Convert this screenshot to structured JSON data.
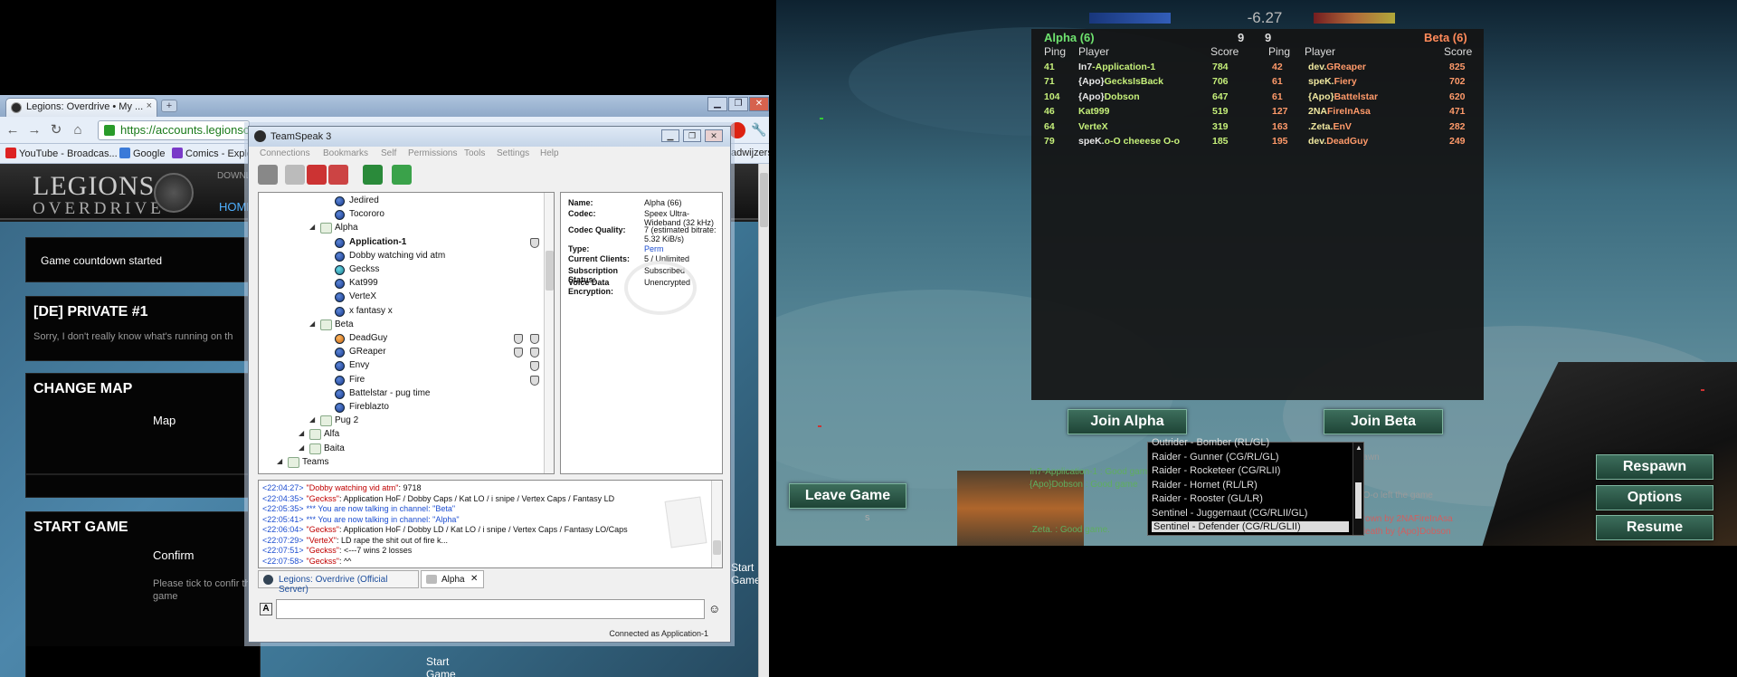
{
  "browser": {
    "tab_title": "Legions: Overdrive • My ...",
    "tab_close": "×",
    "newtab": "+",
    "address": "https://accounts.legionsovei",
    "bookmarks": [
      "YouTube - Broadcas...",
      "Google",
      "Comics - Explo"
    ],
    "bookmark_right": "adwijzers",
    "site_logo_line1": "LEGIONS",
    "site_logo_line2": "OVERDRIVE",
    "nav_download": "DOWNL",
    "nav_home": "HOME",
    "notice": "Game countdown started",
    "server_title": "[DE] PRIVATE #1",
    "server_desc": "Sorry, I don't really know what's running on th",
    "change_map_title": "CHANGE MAP",
    "map_label": "Map",
    "map_value": "---",
    "start_game_title": "START GAME",
    "confirm_label": "Confirm",
    "tick_hint": "Please tick to confir the game",
    "start_button": "Start Game"
  },
  "teamspeak": {
    "title": "TeamSpeak 3",
    "menu": [
      "Connections",
      "Bookmarks",
      "Self",
      "Permissions",
      "Tools",
      "Settings",
      "Help"
    ],
    "tree": [
      {
        "label": "Jedired",
        "type": "client",
        "color": "blue"
      },
      {
        "label": "Tocororo",
        "type": "client",
        "color": "blue"
      },
      {
        "label": "Alpha",
        "type": "channel"
      },
      {
        "label": "Application-1",
        "type": "client",
        "color": "blue",
        "bold": true
      },
      {
        "label": "Dobby watching vid atm",
        "type": "client",
        "color": "blue"
      },
      {
        "label": "Geckss",
        "type": "client",
        "color": "cyan"
      },
      {
        "label": "Kat999",
        "type": "client",
        "color": "blue"
      },
      {
        "label": "VerteX",
        "type": "client",
        "color": "blue"
      },
      {
        "label": "x fantasy x",
        "type": "client",
        "color": "blue"
      },
      {
        "label": "Beta",
        "type": "channel"
      },
      {
        "label": "DeadGuy",
        "type": "client",
        "color": "orange"
      },
      {
        "label": "GReaper",
        "type": "client",
        "color": "blue"
      },
      {
        "label": "Envy",
        "type": "client",
        "color": "blue"
      },
      {
        "label": "Fire",
        "type": "client",
        "color": "blue"
      },
      {
        "label": "Battelstar - pug time",
        "type": "client",
        "color": "blue"
      },
      {
        "label": "Fireblazto",
        "type": "client",
        "color": "blue"
      },
      {
        "label": "Pug 2",
        "type": "channel"
      },
      {
        "label": "Alfa",
        "type": "subchannel"
      },
      {
        "label": "Baita",
        "type": "subchannel"
      },
      {
        "label": "Teams",
        "type": "group"
      }
    ],
    "info": [
      {
        "k": "Name:",
        "v": "Alpha (66)"
      },
      {
        "k": "Codec:",
        "v": "Speex Ultra-Wideband (32 kHz)"
      },
      {
        "k": "Codec Quality:",
        "v": "7 (estimated bitrate: 5.32 KiB/s)"
      },
      {
        "k": "Type:",
        "v": "Perm"
      },
      {
        "k": "Current Clients:",
        "v": "5 / Unlimited"
      },
      {
        "k": "Subscription Status:",
        "v": "Subscribed"
      },
      {
        "k": "Voice Data Encryption:",
        "v": "Unencrypted"
      }
    ],
    "chat": [
      {
        "time": "<22:04:27>",
        "who": "\"Dobby watching vid atm\"",
        "msg": ": 9718",
        "color": "#c00000"
      },
      {
        "time": "<22:04:35>",
        "who": "\"Geckss\"",
        "msg": ": Application HoF / Dobby Caps / Kat LO / i snipe / Vertex Caps / Fantasy LD",
        "color": "#c00000"
      },
      {
        "time": "<22:05:35>",
        "who": "*** You are now talking in channel: ",
        "msg": "\"Beta\"",
        "color": "#1c4dd0"
      },
      {
        "time": "<22:05:41>",
        "who": "*** You are now talking in channel: ",
        "msg": "\"Alpha\"",
        "color": "#1c4dd0"
      },
      {
        "time": "<22:06:04>",
        "who": "\"Geckss\"",
        "msg": ": Application HoF / Dobby LD / Kat LO / i snipe / Vertex Caps / Fantasy LO/Caps",
        "color": "#c00000"
      },
      {
        "time": "<22:07:29>",
        "who": "\"VerteX\"",
        "msg": ": LD rape the shit out of fire k...",
        "color": "#c00000"
      },
      {
        "time": "<22:07:51>",
        "who": "\"Geckss\"",
        "msg": ": <---7 wins 2 losses",
        "color": "#c00000"
      },
      {
        "time": "<22:07:58>",
        "who": "\"Geckss\"",
        "msg": ": ^^",
        "color": "#c00000"
      }
    ],
    "tab1": "Legions: Overdrive (Official Server)",
    "tab2": "Alpha",
    "tab2_close": "✕",
    "status": "Connected as Application-1"
  },
  "game": {
    "hud_score": "-6.27",
    "alpha_header": "Alpha (6)",
    "alpha_count": "9",
    "beta_count": "9",
    "beta_header": "Beta (6)",
    "col_ping": "Ping",
    "col_player": "Player",
    "col_score": "Score",
    "alpha_rows": [
      {
        "ping": "41",
        "tag": "In7",
        "name": "-Application-1",
        "score": "784"
      },
      {
        "ping": "71",
        "tag": "{Apo}",
        "name": "GecksIsBack",
        "score": "706"
      },
      {
        "ping": "104",
        "tag": "{Apo}",
        "name": "Dobson",
        "score": "647"
      },
      {
        "ping": "46",
        "tag": "",
        "name": "Kat999",
        "score": "519"
      },
      {
        "ping": "64",
        "tag": "",
        "name": "VerteX",
        "score": "319"
      },
      {
        "ping": "79",
        "tag": "speK.",
        "name": "o-O cheeese O-o",
        "score": "185"
      }
    ],
    "beta_rows": [
      {
        "ping": "42",
        "tag": "dev.",
        "name": "GReaper",
        "score": "825"
      },
      {
        "ping": "61",
        "tag": "speK.",
        "name": "Fiery",
        "score": "702"
      },
      {
        "ping": "61",
        "tag": "{Apo}",
        "name": "Battelstar",
        "score": "620"
      },
      {
        "ping": "127",
        "tag": "2NA",
        "name": "FireInAsa",
        "score": "471"
      },
      {
        "ping": "163",
        "tag": ".Zeta.",
        "name": "EnV",
        "score": "282"
      },
      {
        "ping": "195",
        "tag": "dev.",
        "name": "DeadGuy",
        "score": "249"
      }
    ],
    "join_alpha": "Join Alpha",
    "join_beta": "Join Beta",
    "leave_game": "Leave Game",
    "respawn": "Respawn",
    "options": "Options",
    "resume": "Resume",
    "class_options": [
      "Outrider - Bomber (RL/GL)",
      "Raider - Gunner (CG/RL/GL)",
      "Raider - Rocketeer (CG/RLII)",
      "Raider - Hornet (RL/LR)",
      "Raider - Rooster (GL/LR)",
      "Sentinel - Juggernaut (CG/RLII/GL)",
      "Sentinel - Defender (CG/RL/GLII)"
    ],
    "killfeed": [
      {
        "text": "In7-Application-1 : Good game",
        "color": "#5fae5f"
      },
      {
        "text": "{Apo}Dobson : Good game",
        "color": "#5fae5f"
      },
      {
        "text": ".Zeta. : Good game.",
        "color": "#5fae5f"
      },
      {
        "text": "sBack decided to respawn",
        "color": "#9a9a9a"
      },
      {
        "text": "cheeese O-o left the game",
        "color": "#9a9a9a"
      },
      {
        "text": "as thrown by 2NAFireInAsa",
        "color": "#d06060"
      },
      {
        "text": "d to death by {Apo}Dobson",
        "color": "#d06060"
      }
    ],
    "hud_small": "s"
  }
}
